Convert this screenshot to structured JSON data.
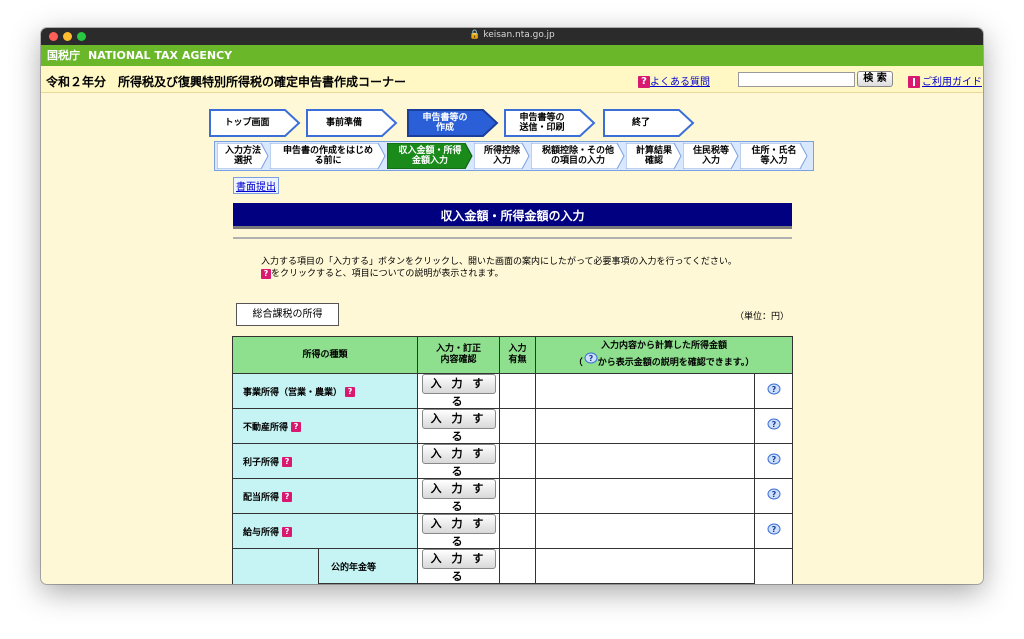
{
  "browser": {
    "url": "keisan.nta.go.jp"
  },
  "agency": {
    "short": "国税庁",
    "name": "NATIONAL TAX AGENCY"
  },
  "header": {
    "title": "令和２年分　所得税及び復興特別所得税の確定申告書作成コーナー",
    "faq_label": "よくある質問",
    "search_placeholder": "",
    "search_button": "検 索",
    "guide_label": "ご利用ガイド"
  },
  "steps": [
    {
      "label": "トップ画面"
    },
    {
      "label": "事前準備"
    },
    {
      "label": "申告書等の\n作成"
    },
    {
      "label": "申告書等の\n送信・印刷"
    },
    {
      "label": "終了"
    }
  ],
  "substeps": [
    {
      "label": "入力方法\n選択"
    },
    {
      "label": "申告書の作成をはじめ\nる前に"
    },
    {
      "label": "収入金額・所得\n金額入力"
    },
    {
      "label": "所得控除\n入力"
    },
    {
      "label": "税額控除・その他\nの項目の入力"
    },
    {
      "label": "計算結果\n確認"
    },
    {
      "label": "住民税等\n入力"
    },
    {
      "label": "住所・氏名\n等入力"
    }
  ],
  "submit_link": "書面提出",
  "section_title": "収入金額・所得金額の入力",
  "instructions": {
    "line1": "入力する項目の「入力する」ボタンをクリックし、開いた画面の案内にしたがって必要事項の入力を行ってください。",
    "line2": "をクリックすると、項目についての説明が表示されます。"
  },
  "category_label": "総合課税の所得",
  "unit_label": "（単位：円）",
  "table": {
    "headers": {
      "type": "所得の種類",
      "action": "入力・訂正\n内容確認",
      "flag": "入力\n有無",
      "calc_line1": "入力内容から計算した所得金額",
      "calc_line2_pre": "（",
      "calc_line2_post": "から表示金額の説明を確認できます。）"
    },
    "button_label": "入 力 す る",
    "rows": [
      {
        "type": "事業所得（営業・農業）"
      },
      {
        "type": "不動産所得"
      },
      {
        "type": "利子所得"
      },
      {
        "type": "配当所得"
      },
      {
        "type": "給与所得"
      }
    ],
    "sub_row": {
      "type": "公的年金等"
    }
  },
  "colors": {
    "agency_bar": "#6ab82a",
    "section_title_bg": "#000080",
    "table_header_bg": "#8ee08e",
    "type_cell_bg": "#c6f4f4",
    "active_step": "#2a5fd8",
    "active_substep": "#1a8a1a"
  }
}
